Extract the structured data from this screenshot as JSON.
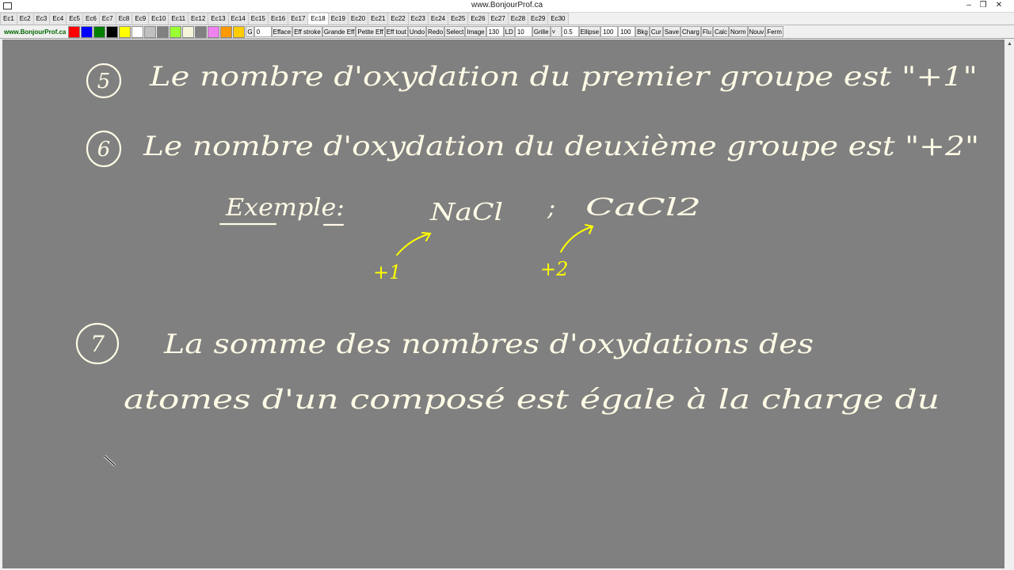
{
  "window": {
    "title": "www.BonjourProf.ca"
  },
  "tabs": [
    "Ec1",
    "Ec2",
    "Ec3",
    "Ec4",
    "Ec5",
    "Ec6",
    "Ec7",
    "Ec8",
    "Ec9",
    "Ec10",
    "Ec11",
    "Ec12",
    "Ec13",
    "Ec14",
    "Ec15",
    "Ec16",
    "Ec17",
    "Ec18",
    "Ec19",
    "Ec20",
    "Ec21",
    "Ec22",
    "Ec23",
    "Ec24",
    "Ec25",
    "Ec26",
    "Ec27",
    "Ec28",
    "Ec29",
    "Ec30"
  ],
  "active_tab": "Ec18",
  "toolbar": {
    "site": "www.BonjourProf.ca",
    "palette": [
      "#ff0000",
      "#0000ff",
      "#008000",
      "#000000",
      "#ffff00",
      "#ffffff",
      "#c0c0c0",
      "#808080",
      "#99ff33",
      "#f5f5dc",
      "#808080",
      "#ee82ee",
      "#ff9900",
      "#ffcc00"
    ],
    "g_label": "G",
    "g_value": "0",
    "efface": "Efface",
    "eff_stroke": "Eff stroke",
    "grande_eff": "Grande Eff",
    "petite_eff": "Petite Eff",
    "eff_tout": "Eff tout",
    "undo": "Undo",
    "redo": "Redo",
    "select": "Select",
    "image": "Image",
    "image_value": "130",
    "ld_label": "LD",
    "ld_value": "10",
    "grille": "Grille",
    "grille_value": "0.5",
    "ellipse": "Ellipse",
    "ellipse_w": "100",
    "ellipse_h": "100",
    "bkg": "Bkg",
    "cur": "Cur",
    "save": "Save",
    "charg": "Charg",
    "flu": "Flu",
    "calc": "Calc",
    "norm": "Norm",
    "nouv": "Nouv",
    "ferm": "Ferm"
  },
  "board": {
    "background": "#808080",
    "ink_color": "#fffbe6",
    "accent_color": "#ffff00",
    "lines": {
      "l5_num": "5",
      "l5_text": "Le nombre d'oxydation du premier groupe est \"+1\"",
      "l6_num": "6",
      "l6_text": "Le nombre d'oxydation du deuxième groupe est \"+2\"",
      "example_label": "Exemple:",
      "formula_1": "NaCl",
      "separator": ";",
      "formula_2": "CaCl2",
      "ox_1": "+1",
      "ox_2": "+2",
      "l7_num": "7",
      "l7_text_a": "La somme des nombres d'oxydations des",
      "l7_text_b": "atomes d'un composé est égale à la charge du"
    }
  }
}
